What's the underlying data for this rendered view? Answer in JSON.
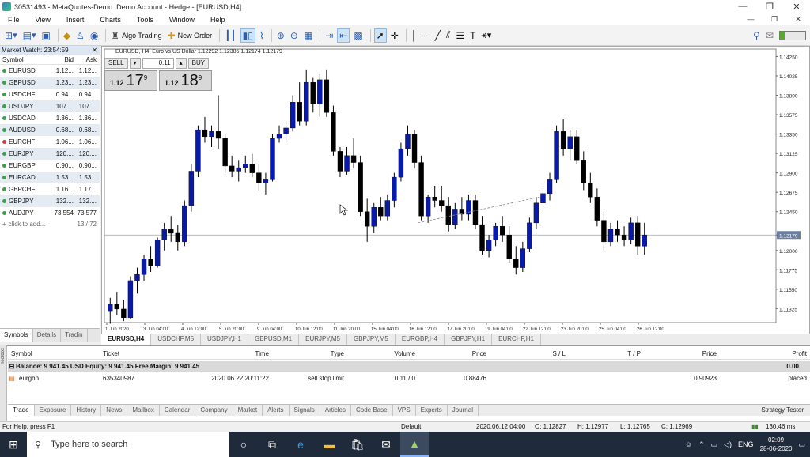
{
  "window": {
    "title": "30531493 - MetaQuotes-Demo: Demo Account - Hedge - [EURUSD,H4]",
    "controls": [
      "—",
      "❐",
      "✕"
    ]
  },
  "menu": [
    "File",
    "View",
    "Insert",
    "Charts",
    "Tools",
    "Window",
    "Help"
  ],
  "mdi_controls": [
    "—",
    "❐",
    "✕"
  ],
  "toolbar": {
    "algo_trading": "Algo Trading",
    "new_order": "New Order"
  },
  "market_watch": {
    "title": "Market Watch: 23:54:59",
    "cols": {
      "symbol": "Symbol",
      "bid": "Bid",
      "ask": "Ask"
    },
    "rows": [
      {
        "sym": "EURUSD",
        "bid": "1.12...",
        "ask": "1.12...",
        "up": true
      },
      {
        "sym": "GBPUSD",
        "bid": "1.23...",
        "ask": "1.23...",
        "up": true
      },
      {
        "sym": "USDCHF",
        "bid": "0.94...",
        "ask": "0.94...",
        "up": true
      },
      {
        "sym": "USDJPY",
        "bid": "107....",
        "ask": "107....",
        "up": true
      },
      {
        "sym": "USDCAD",
        "bid": "1.36...",
        "ask": "1.36...",
        "up": true
      },
      {
        "sym": "AUDUSD",
        "bid": "0.68...",
        "ask": "0.68...",
        "up": true
      },
      {
        "sym": "EURCHF",
        "bid": "1.06...",
        "ask": "1.06...",
        "up": false
      },
      {
        "sym": "EURJPY",
        "bid": "120....",
        "ask": "120....",
        "up": true
      },
      {
        "sym": "EURGBP",
        "bid": "0.90...",
        "ask": "0.90...",
        "up": true
      },
      {
        "sym": "EURCAD",
        "bid": "1.53...",
        "ask": "1.53...",
        "up": true
      },
      {
        "sym": "GBPCHF",
        "bid": "1.16...",
        "ask": "1.17...",
        "up": true
      },
      {
        "sym": "GBPJPY",
        "bid": "132....",
        "ask": "132....",
        "up": true
      },
      {
        "sym": "AUDJPY",
        "bid": "73.554",
        "ask": "73.577",
        "up": true
      }
    ],
    "add_label": "click to add...",
    "count": "13 / 72",
    "tabs": [
      "Symbols",
      "Details",
      "Tradin"
    ]
  },
  "chart": {
    "title": "EURUSD, H4:  Euro vs US Dollar  1.12292 1.12385 1.12174 1.12179",
    "trade_panel": {
      "sell": "SELL",
      "buy": "BUY",
      "lot": "0.11",
      "sell_small": "1.12",
      "sell_big": "17",
      "sell_pip": "9",
      "buy_small": "1.12",
      "buy_big": "18",
      "buy_pip": "9"
    },
    "price_labels": [
      "1.14250",
      "1.14025",
      "1.13800",
      "1.13575",
      "1.13350",
      "1.13125",
      "1.12900",
      "1.12675",
      "1.12450",
      "1.12179",
      "1.12000",
      "1.11775",
      "1.11550",
      "1.11325"
    ],
    "current_price": "1.12179",
    "time_labels": [
      "1 Jun 2020",
      "3 Jun 04:00",
      "4 Jun 12:00",
      "5 Jun 20:00",
      "9 Jun 04:00",
      "10 Jun 12:00",
      "11 Jun 20:00",
      "15 Jun 04:00",
      "16 Jun 12:00",
      "17 Jun 20:00",
      "19 Jun 04:00",
      "22 Jun 12:00",
      "23 Jun 20:00",
      "25 Jun 04:00",
      "26 Jun 12:00"
    ],
    "tabs": [
      "EURUSD,H4",
      "USDCHF,M5",
      "USDJPY,H1",
      "GBPUSD,M1",
      "EURJPY,M5",
      "GBPJPY,M5",
      "EURGBP,H4",
      "GBPJPY,H1",
      "EURCHF,H1"
    ]
  },
  "chart_data": {
    "type": "candlestick",
    "title": "EURUSD, H4",
    "ylim": [
      1.112,
      1.143
    ],
    "ohlc_approx": [
      [
        1.113,
        1.1145,
        1.1115,
        1.1138
      ],
      [
        1.1138,
        1.1152,
        1.1125,
        1.1132
      ],
      [
        1.1132,
        1.1142,
        1.1118,
        1.1122
      ],
      [
        1.1122,
        1.117,
        1.112,
        1.1165
      ],
      [
        1.1165,
        1.118,
        1.115,
        1.1172
      ],
      [
        1.1172,
        1.1195,
        1.1165,
        1.119
      ],
      [
        1.119,
        1.1205,
        1.1175,
        1.1182
      ],
      [
        1.1182,
        1.1215,
        1.118,
        1.1212
      ],
      [
        1.1212,
        1.1232,
        1.12,
        1.1225
      ],
      [
        1.1225,
        1.124,
        1.121,
        1.122
      ],
      [
        1.122,
        1.123,
        1.12,
        1.121
      ],
      [
        1.121,
        1.1258,
        1.1205,
        1.1252
      ],
      [
        1.1252,
        1.13,
        1.1245,
        1.1292
      ],
      [
        1.1292,
        1.1345,
        1.1285,
        1.134
      ],
      [
        1.134,
        1.1355,
        1.1325,
        1.1332
      ],
      [
        1.1332,
        1.1345,
        1.132,
        1.1338
      ],
      [
        1.1338,
        1.138,
        1.1318,
        1.133
      ],
      [
        1.133,
        1.1335,
        1.129,
        1.1298
      ],
      [
        1.1298,
        1.131,
        1.1285,
        1.1292
      ],
      [
        1.1292,
        1.1305,
        1.128,
        1.1296
      ],
      [
        1.1296,
        1.131,
        1.129,
        1.13
      ],
      [
        1.13,
        1.1312,
        1.1285,
        1.129
      ],
      [
        1.129,
        1.13,
        1.127,
        1.1278
      ],
      [
        1.1278,
        1.129,
        1.1265,
        1.1282
      ],
      [
        1.1282,
        1.1335,
        1.128,
        1.133
      ],
      [
        1.133,
        1.1345,
        1.1325,
        1.1335
      ],
      [
        1.1335,
        1.135,
        1.1325,
        1.1342
      ],
      [
        1.1342,
        1.138,
        1.1338,
        1.1372
      ],
      [
        1.1372,
        1.1395,
        1.1345,
        1.135
      ],
      [
        1.135,
        1.141,
        1.1345,
        1.1395
      ],
      [
        1.1395,
        1.14,
        1.136,
        1.137
      ],
      [
        1.137,
        1.1405,
        1.1355,
        1.1398
      ],
      [
        1.1398,
        1.141,
        1.1355,
        1.136
      ],
      [
        1.136,
        1.1368,
        1.131,
        1.1315
      ],
      [
        1.1315,
        1.132,
        1.1285,
        1.1292
      ],
      [
        1.1292,
        1.132,
        1.1288,
        1.131
      ],
      [
        1.131,
        1.133,
        1.1295,
        1.1302
      ],
      [
        1.1302,
        1.131,
        1.124,
        1.1245
      ],
      [
        1.1245,
        1.126,
        1.121,
        1.1228
      ],
      [
        1.1228,
        1.1255,
        1.122,
        1.125
      ],
      [
        1.125,
        1.1262,
        1.1235,
        1.124
      ],
      [
        1.124,
        1.1265,
        1.1235,
        1.1258
      ],
      [
        1.1258,
        1.129,
        1.125,
        1.1285
      ],
      [
        1.1285,
        1.1325,
        1.128,
        1.1318
      ],
      [
        1.1318,
        1.1345,
        1.131,
        1.1335
      ],
      [
        1.1335,
        1.134,
        1.1295,
        1.1302
      ],
      [
        1.1302,
        1.131,
        1.1235,
        1.124
      ],
      [
        1.124,
        1.1265,
        1.1232,
        1.1262
      ],
      [
        1.1262,
        1.1275,
        1.125,
        1.1258
      ],
      [
        1.1258,
        1.1275,
        1.1245,
        1.1252
      ],
      [
        1.1252,
        1.1262,
        1.1222,
        1.123
      ],
      [
        1.123,
        1.1255,
        1.1225,
        1.1248
      ],
      [
        1.1248,
        1.1262,
        1.1235,
        1.1242
      ],
      [
        1.1242,
        1.1265,
        1.1235,
        1.1258
      ],
      [
        1.1258,
        1.1265,
        1.1225,
        1.123
      ],
      [
        1.123,
        1.124,
        1.1195,
        1.12
      ],
      [
        1.12,
        1.1218,
        1.1192,
        1.1212
      ],
      [
        1.1212,
        1.1232,
        1.1205,
        1.1228
      ],
      [
        1.1228,
        1.124,
        1.121,
        1.1218
      ],
      [
        1.1218,
        1.1228,
        1.1185,
        1.119
      ],
      [
        1.119,
        1.1205,
        1.1172,
        1.118
      ],
      [
        1.118,
        1.121,
        1.1175,
        1.1202
      ],
      [
        1.1202,
        1.1238,
        1.1198,
        1.1232
      ],
      [
        1.1232,
        1.1262,
        1.1225,
        1.1255
      ],
      [
        1.1255,
        1.1272,
        1.1245,
        1.1266
      ],
      [
        1.1266,
        1.129,
        1.1258,
        1.1282
      ],
      [
        1.1282,
        1.1345,
        1.1278,
        1.1338
      ],
      [
        1.1338,
        1.1352,
        1.131,
        1.1318
      ],
      [
        1.1318,
        1.134,
        1.1305,
        1.1332
      ],
      [
        1.1332,
        1.134,
        1.13,
        1.1305
      ],
      [
        1.1305,
        1.1315,
        1.127,
        1.1278
      ],
      [
        1.1278,
        1.129,
        1.1255,
        1.1262
      ],
      [
        1.1262,
        1.1272,
        1.1228,
        1.1235
      ],
      [
        1.1235,
        1.1245,
        1.12,
        1.121
      ],
      [
        1.121,
        1.1232,
        1.1205,
        1.1225
      ],
      [
        1.1225,
        1.1235,
        1.121,
        1.1218
      ],
      [
        1.1218,
        1.1228,
        1.1205,
        1.1212
      ],
      [
        1.1212,
        1.1238,
        1.1208,
        1.1232
      ],
      [
        1.1232,
        1.124,
        1.1195,
        1.1205
      ],
      [
        1.1205,
        1.1232,
        1.1195,
        1.1218
      ]
    ]
  },
  "terminal": {
    "side_label": "Toolbox",
    "cols": [
      "Symbol",
      "Ticket",
      "Time",
      "Type",
      "Volume",
      "Price",
      "S / L",
      "T / P",
      "Price",
      "Profit"
    ],
    "balance": "Balance: 9 941.45 USD  Equity: 9 941.45  Free Margin: 9 941.45",
    "balance_profit": "0.00",
    "order": {
      "symbol": "eurgbp",
      "ticket": "635340987",
      "time": "2020.06.22 20:11:22",
      "type": "sell stop limit",
      "volume": "0.11 / 0",
      "price": "0.88476",
      "sl": "",
      "tp": "",
      "cur_price": "0.90923",
      "status": "placed"
    },
    "tabs": [
      "Trade",
      "Exposure",
      "History",
      "News",
      "Mailbox",
      "Calendar",
      "Company",
      "Market",
      "Alerts",
      "Signals",
      "Articles",
      "Code Base",
      "VPS",
      "Experts",
      "Journal"
    ],
    "strategy_tester": "Strategy Tester"
  },
  "status": {
    "help": "For Help, press F1",
    "profile": "Default",
    "datetime": "2020.06.12 04:00",
    "o": "O: 1.12827",
    "h": "H: 1.12977",
    "l": "L: 1.12765",
    "c": "C: 1.12969",
    "conn": "130.46 ms"
  },
  "taskbar": {
    "search": "Type here to search",
    "lang": "ENG",
    "time": "02:09",
    "date": "28-06-2020"
  }
}
